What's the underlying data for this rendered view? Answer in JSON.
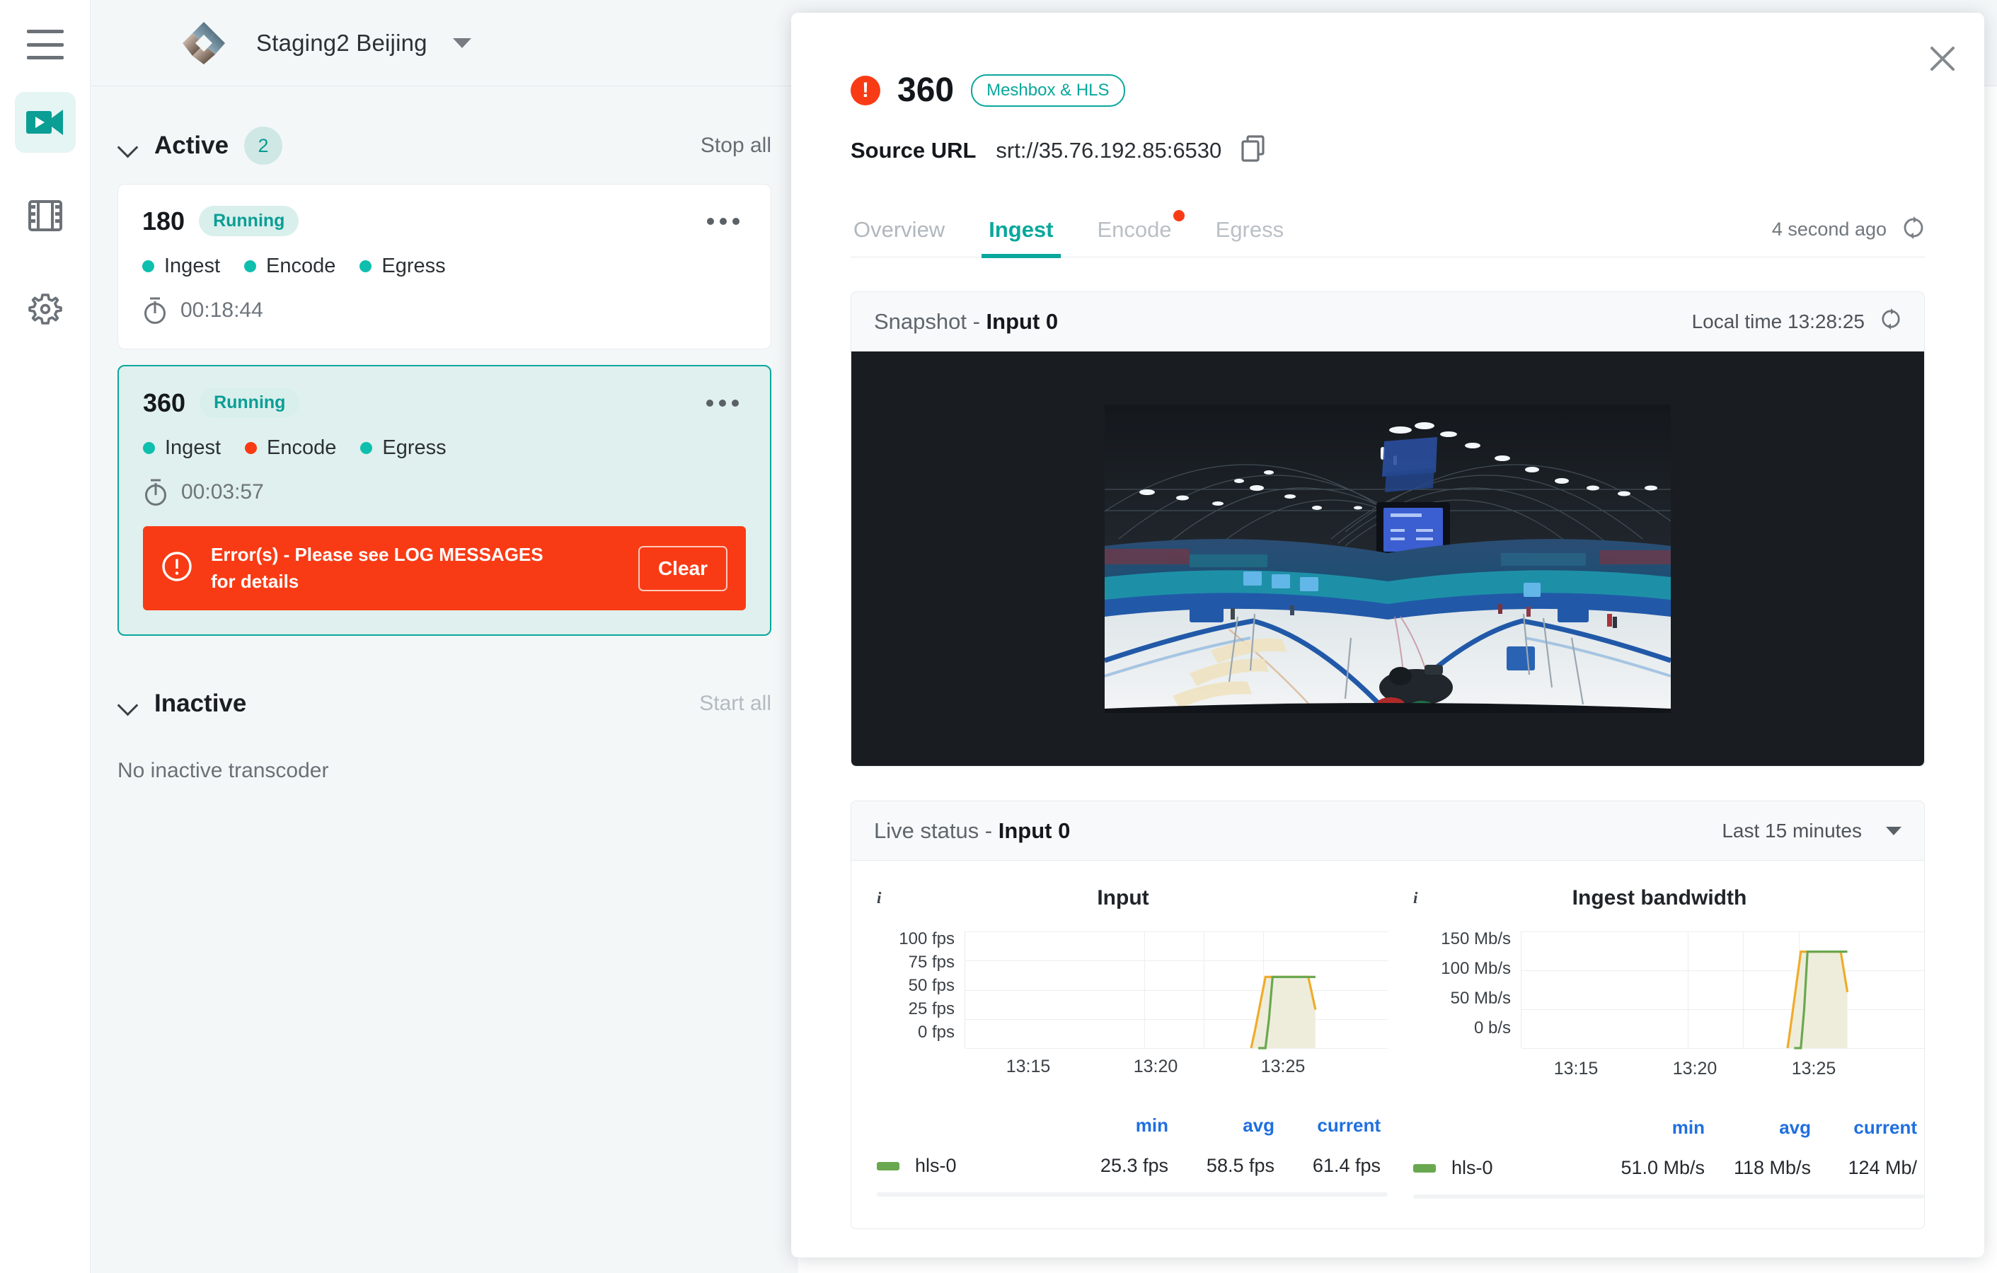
{
  "rail": {
    "items": [
      {
        "name": "hamburger-menu",
        "label": "Menu"
      },
      {
        "name": "live-transcoders",
        "label": "Live transcoders",
        "active": true
      },
      {
        "name": "media-library",
        "label": "Media library",
        "active": false
      },
      {
        "name": "settings",
        "label": "Settings",
        "active": false
      }
    ]
  },
  "topbar": {
    "logo_name": "app-logo",
    "project_name": "Staging2 Beijing",
    "caret": "project-selector-caret"
  },
  "sidebar": {
    "active_section": {
      "title": "Active",
      "count": "2",
      "action_label": "Stop all"
    },
    "inactive_section": {
      "title": "Inactive",
      "action_label": "Start all",
      "empty_text": "No inactive transcoder"
    },
    "cards": [
      {
        "title": "180",
        "status": "Running",
        "stages": [
          {
            "label": "Ingest",
            "color": "#0fbfae"
          },
          {
            "label": "Encode",
            "color": "#0fbfae"
          },
          {
            "label": "Egress",
            "color": "#0fbfae"
          }
        ],
        "uptime": "00:18:44",
        "selected": false,
        "error": null
      },
      {
        "title": "360",
        "status": "Running",
        "stages": [
          {
            "label": "Ingest",
            "color": "#0fbfae"
          },
          {
            "label": "Encode",
            "color": "#f93b15"
          },
          {
            "label": "Egress",
            "color": "#0fbfae"
          }
        ],
        "uptime": "00:03:57",
        "selected": true,
        "error": {
          "message": "Error(s) - Please see LOG MESSAGES for details",
          "button_label": "Clear"
        }
      }
    ]
  },
  "modal": {
    "close_label": "Close",
    "title": "360",
    "tag": "Meshbox & HLS",
    "has_error": true,
    "source_url_label": "Source URL",
    "source_url_value": "srt://35.76.192.85:6530",
    "copy_label": "Copy source URL",
    "tabs": [
      {
        "label": "Overview",
        "active": false,
        "alert": false
      },
      {
        "label": "Ingest",
        "active": true,
        "alert": false
      },
      {
        "label": "Encode",
        "active": false,
        "alert": true
      },
      {
        "label": "Egress",
        "active": false,
        "alert": false
      }
    ],
    "last_updated": "4 second ago",
    "refresh_label": "Refresh",
    "snapshot_panel": {
      "title_prefix": "Snapshot - ",
      "title_strong": "Input 0",
      "time_label": "Local time 13:28:25",
      "refresh_label": "Refresh snapshot"
    },
    "livestatus_panel": {
      "title_prefix": "Live status - ",
      "title_strong": "Input 0",
      "range_label": "Last 15 minutes"
    }
  },
  "chart_data": [
    {
      "type": "area",
      "title": "Input",
      "xlabel": "",
      "ylabel": "fps",
      "ylim": [
        0,
        100
      ],
      "yticks": [
        "100 fps",
        "75 fps",
        "50 fps",
        "25 fps",
        "0 fps"
      ],
      "ytick_values": [
        100,
        75,
        50,
        25,
        0
      ],
      "xticks": [
        "13:15",
        "13:20",
        "13:25"
      ],
      "grid": true,
      "legend_position": "bottom",
      "stat_headers": [
        "min",
        "avg",
        "current"
      ],
      "series": [
        {
          "name": "hls-0",
          "color": "#6aa84f",
          "min": "25.3 fps",
          "avg": "58.5 fps",
          "current": "61.4 fps",
          "x": [
            13.41,
            13.42,
            13.425,
            13.43,
            13.46,
            13.49
          ],
          "values": [
            0,
            0,
            25,
            61,
            61,
            61
          ]
        },
        {
          "name": "series-2",
          "color": "#f0ab2a",
          "min": "",
          "avg": "",
          "current": "",
          "x": [
            13.4,
            13.405,
            13.42,
            13.46,
            13.48,
            13.49
          ],
          "values": [
            0,
            14,
            61,
            61,
            61,
            33
          ]
        }
      ]
    },
    {
      "type": "area",
      "title": "Ingest bandwidth",
      "xlabel": "",
      "ylabel": "Mb/s",
      "ylim": [
        0,
        150
      ],
      "yticks": [
        "150 Mb/s",
        "100 Mb/s",
        "50 Mb/s",
        "0 b/s"
      ],
      "ytick_values": [
        150,
        100,
        50,
        0
      ],
      "xticks": [
        "13:15",
        "13:20",
        "13:25"
      ],
      "grid": true,
      "legend_position": "bottom",
      "stat_headers": [
        "min",
        "avg",
        "current"
      ],
      "series": [
        {
          "name": "hls-0",
          "color": "#6aa84f",
          "min": "51.0 Mb/s",
          "avg": "118 Mb/s",
          "current": "124 Mb/",
          "x": [
            13.41,
            13.42,
            13.425,
            13.43,
            13.46,
            13.49
          ],
          "values": [
            0,
            0,
            50,
            124,
            124,
            124
          ]
        },
        {
          "name": "series-2",
          "color": "#f0ab2a",
          "min": "",
          "avg": "",
          "current": "",
          "x": [
            13.4,
            13.405,
            13.42,
            13.46,
            13.48,
            13.49
          ],
          "values": [
            0,
            30,
            124,
            124,
            124,
            72
          ]
        }
      ]
    }
  ]
}
